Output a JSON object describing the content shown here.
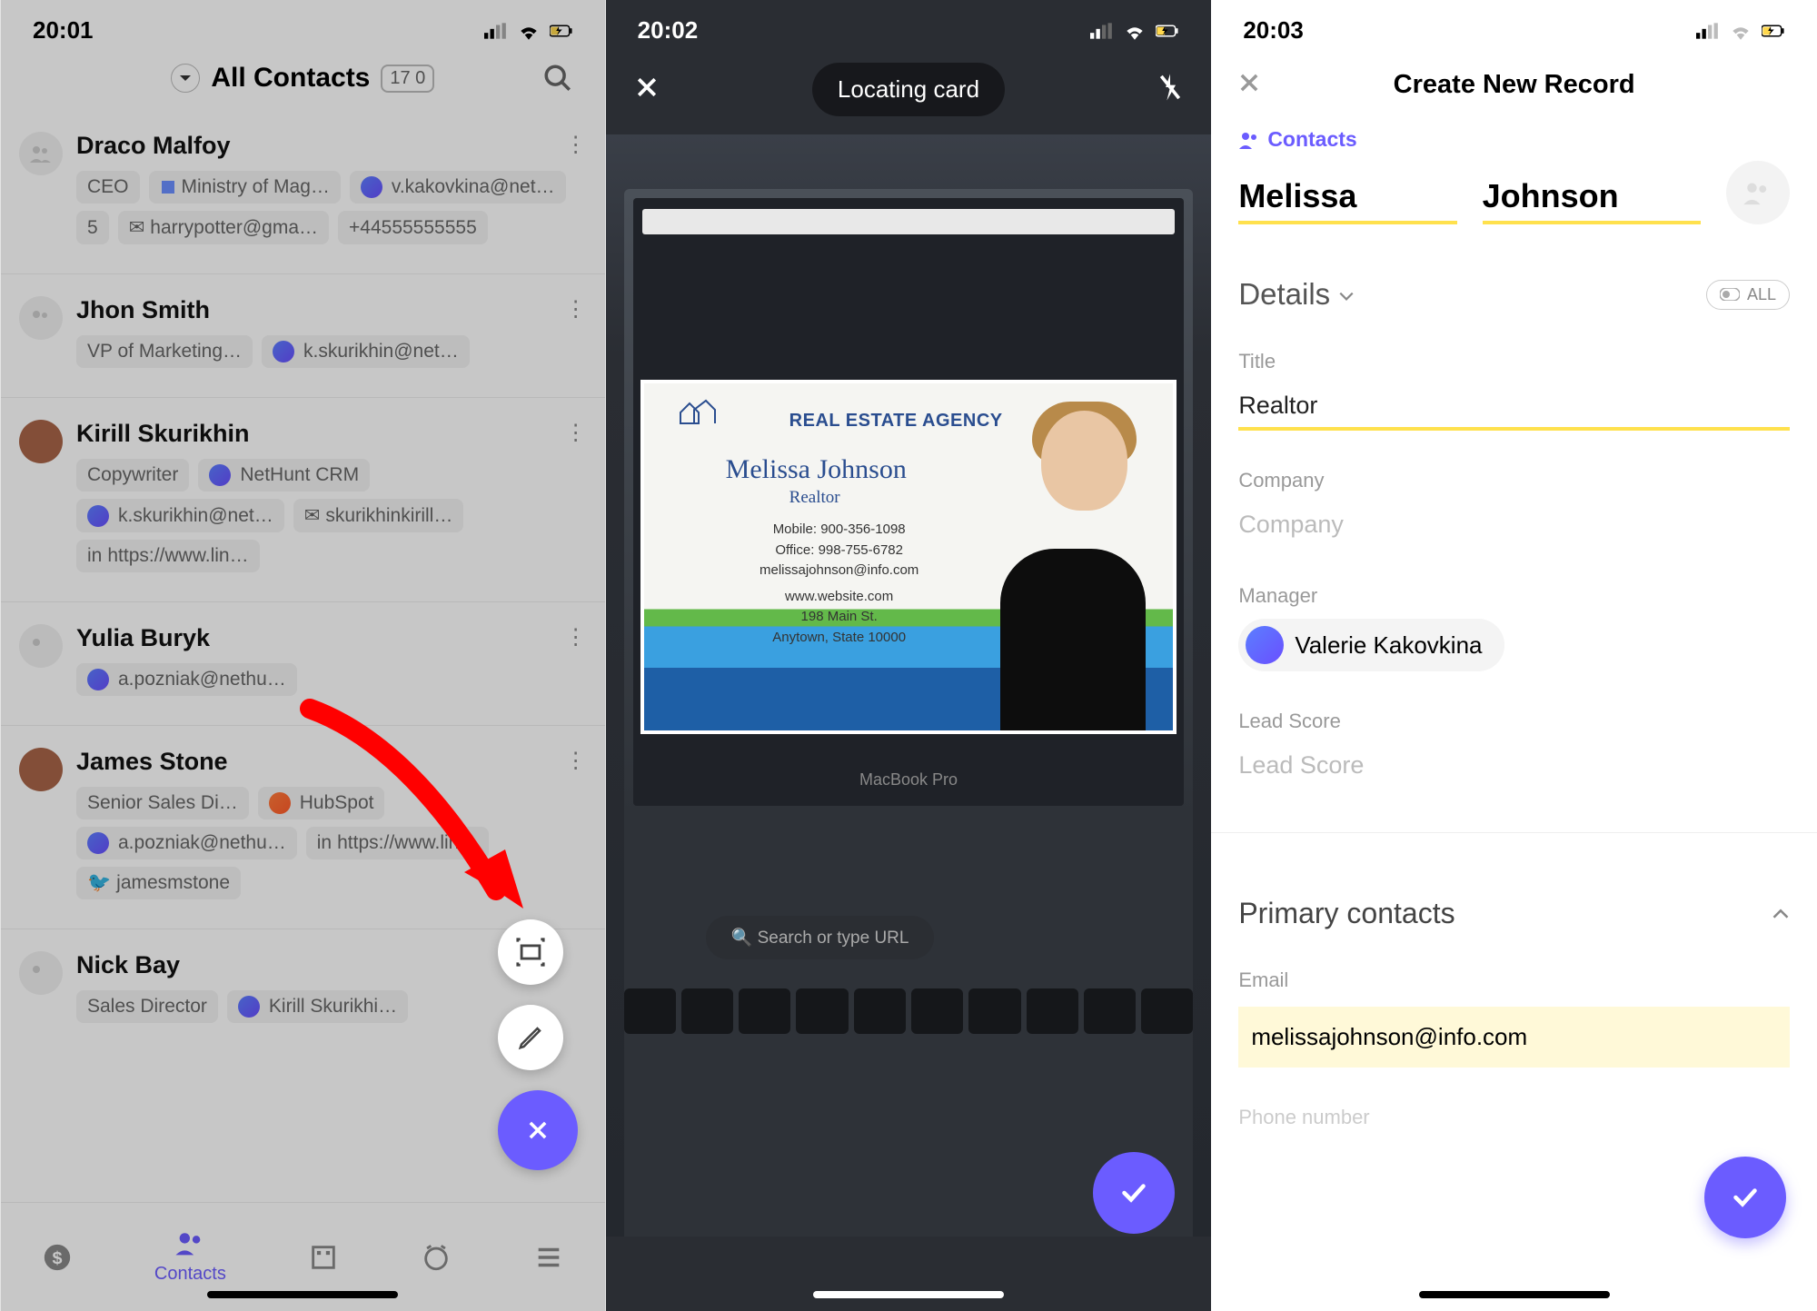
{
  "status": {
    "time1": "20:01",
    "time2": "20:02",
    "time3": "20:03"
  },
  "screen1": {
    "title": "All Contacts",
    "count": "17 0",
    "nav_active": "Contacts",
    "contacts": [
      {
        "name": "Draco Malfoy",
        "role": "CEO",
        "company": "Ministry of Mag…",
        "owner": "v.kakovkina@net…",
        "count": "5",
        "email": "harrypotter@gma…",
        "phone": "+44555555555"
      },
      {
        "name": "Jhon Smith",
        "role": "VP of Marketing…",
        "owner": "k.skurikhin@net…"
      },
      {
        "name": "Kirill Skurikhin",
        "role": "Copywriter",
        "company": "NetHunt CRM",
        "owner": "k.skurikhin@net…",
        "email": "skurikhinkirill…",
        "link": "https://www.lin…"
      },
      {
        "name": "Yulia Buryk",
        "owner": "a.pozniak@nethu…"
      },
      {
        "name": "James Stone",
        "role": "Senior Sales Di…",
        "company": "HubSpot",
        "owner": "a.pozniak@nethu…",
        "link": "https://www.lin…",
        "twitter": "jamesmstone"
      },
      {
        "name": "Nick Bay",
        "role": "Sales Director",
        "owner": "Kirill Skurikhi…"
      }
    ]
  },
  "screen2": {
    "status_text": "Locating card",
    "card": {
      "agency": "REAL ESTATE AGENCY",
      "name": "Melissa Johnson",
      "role": "Realtor",
      "mobile": "Mobile: 900-356-1098",
      "office": "Office: 998-755-6782",
      "email": "melissajohnson@info.com",
      "website": "www.website.com",
      "addr1": "198 Main St.",
      "addr2": "Anytown, State 10000"
    },
    "mac": "MacBook Pro",
    "search": "Search or type URL"
  },
  "screen3": {
    "title": "Create New Record",
    "type_label": "Contacts",
    "first_name": "Melissa",
    "last_name": "Johnson",
    "details": "Details",
    "all": "ALL",
    "labels": {
      "title": "Title",
      "company": "Company",
      "manager": "Manager",
      "lead_score": "Lead Score",
      "primary": "Primary contacts",
      "email": "Email",
      "phone": "Phone number"
    },
    "values": {
      "title": "Realtor",
      "manager": "Valerie Kakovkina",
      "email": "melissajohnson@info.com"
    },
    "placeholders": {
      "company": "Company",
      "lead_score": "Lead Score"
    }
  }
}
